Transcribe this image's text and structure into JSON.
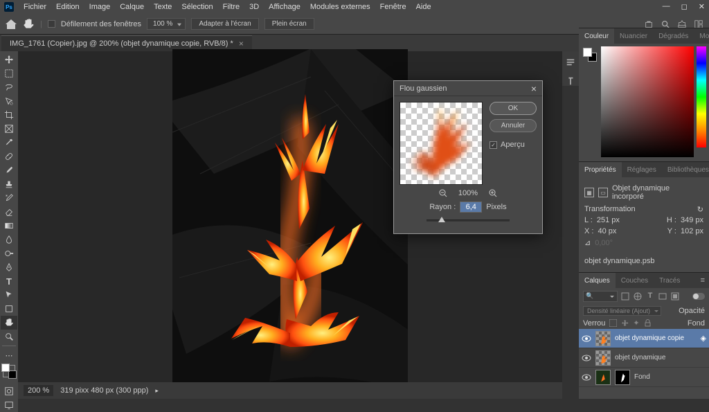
{
  "menu": [
    "Fichier",
    "Edition",
    "Image",
    "Calque",
    "Texte",
    "Sélection",
    "Filtre",
    "3D",
    "Affichage",
    "Modules externes",
    "Fenêtre",
    "Aide"
  ],
  "options": {
    "scrollLabel": "Défilement des fenêtres",
    "zoom": "100 %",
    "fitScreen": "Adapter à l'écran",
    "fullScreen": "Plein écran"
  },
  "document": {
    "tab": "IMG_1761 (Copier).jpg @ 200% (objet dynamique copie, RVB/8) *"
  },
  "dialog": {
    "title": "Flou gaussien",
    "ok": "OK",
    "cancel": "Annuler",
    "preview": "Aperçu",
    "previewZoom": "100%",
    "radiusLabel": "Rayon :",
    "radiusValue": "6,4",
    "radiusUnit": "Pixels"
  },
  "panels": {
    "color": {
      "tabs": [
        "Couleur",
        "Nuancier",
        "Dégradés",
        "Motifs"
      ]
    },
    "props": {
      "tabs": [
        "Propriétés",
        "Réglages",
        "Bibliothèques"
      ],
      "kind": "Objet dynamique incorporé",
      "section": "Transformation",
      "w": "L :",
      "wval": "251 px",
      "h": "H :",
      "hval": "349 px",
      "x": "X :",
      "xval": "40 px",
      "y": "Y :",
      "yval": "102 px",
      "file": "objet dynamique.psb"
    },
    "layers": {
      "tabs": [
        "Calques",
        "Couches",
        "Tracés"
      ],
      "search": "Type",
      "blend": "Densité linéaire (Ajout)",
      "opacityLabel": "Opacité",
      "lockLabel": "Verrou",
      "fillLabel": "Fond",
      "items": [
        {
          "name": "objet dynamique copie",
          "sel": true
        },
        {
          "name": "objet dynamique",
          "sel": false
        },
        {
          "name": "Fond",
          "sel": false
        }
      ]
    }
  },
  "status": {
    "zoom": "200 %",
    "info": "319 pixx 480 px (300 ppp)"
  }
}
